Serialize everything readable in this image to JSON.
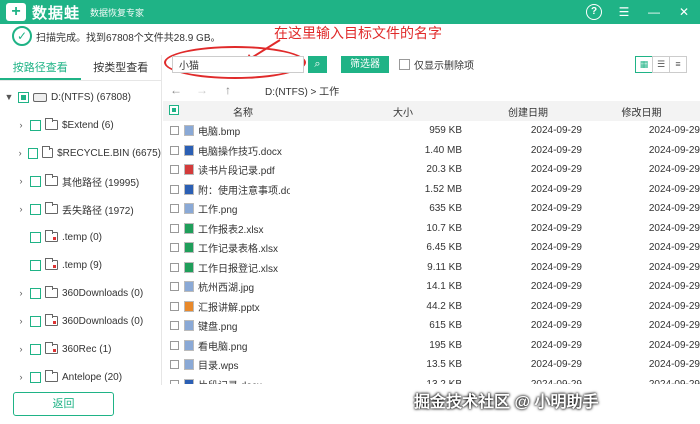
{
  "app": {
    "name": "数据蛙",
    "subtitle": "数据恢复专家",
    "logo_icon": "logo-plus-icon"
  },
  "status": {
    "text": "扫描完成。找到67808个文件共28.9 GB。"
  },
  "annotation": {
    "text": "在这里输入目标文件的名字",
    "color": "#e02a2a"
  },
  "left_tabs": [
    "按路径查看",
    "按类型查看"
  ],
  "tree": [
    {
      "label": "D:(NTFS) (67808)",
      "caret": "▼",
      "icon": "drive-icon",
      "partial": true
    },
    {
      "label": "$Extend (6)",
      "caret": "›",
      "icon": "folder-icon"
    },
    {
      "label": "$RECYCLE.BIN (6675)",
      "caret": "›",
      "icon": "folder-icon"
    },
    {
      "label": "其他路径 (19995)",
      "caret": "›",
      "icon": "folder-icon"
    },
    {
      "label": "丢失路径 (1972)",
      "caret": "›",
      "icon": "folder-icon"
    },
    {
      "label": ".temp (0)",
      "caret": "",
      "icon": "folder-deleted-icon"
    },
    {
      "label": ".temp (9)",
      "caret": "",
      "icon": "folder-deleted-icon"
    },
    {
      "label": "360Downloads (0)",
      "caret": "›",
      "icon": "folder-icon"
    },
    {
      "label": "360Downloads (0)",
      "caret": "›",
      "icon": "folder-deleted-icon"
    },
    {
      "label": "360Rec (1)",
      "caret": "›",
      "icon": "folder-deleted-icon"
    },
    {
      "label": "Antelope (20)",
      "caret": "›",
      "icon": "folder-icon"
    }
  ],
  "back_label": "返回",
  "search": {
    "value": "小猫",
    "filter_label": "筛选器",
    "deleted_only_label": "仅显示删除项"
  },
  "path": "D:(NTFS) > 工作",
  "columns": {
    "name": "名称",
    "size": "大小",
    "created": "创建日期",
    "modified": "修改日期"
  },
  "files": [
    {
      "name": "电脑.bmp",
      "size": "959 KB",
      "created": "2024-09-29",
      "modified": "2024-09-29",
      "icon_color": "#8aa9d6"
    },
    {
      "name": "电脑操作技巧.docx",
      "size": "1.40 MB",
      "created": "2024-09-29",
      "modified": "2024-09-29",
      "icon_color": "#2b5fb4"
    },
    {
      "name": "读书片段记录.pdf",
      "size": "20.3 KB",
      "created": "2024-09-29",
      "modified": "2024-09-29",
      "icon_color": "#d33b3b"
    },
    {
      "name": "附：使用注意事项.docx",
      "size": "1.52 MB",
      "created": "2024-09-29",
      "modified": "2024-09-29",
      "icon_color": "#2b5fb4"
    },
    {
      "name": "工作.png",
      "size": "635 KB",
      "created": "2024-09-29",
      "modified": "2024-09-29",
      "icon_color": "#8aa9d6"
    },
    {
      "name": "工作报表2.xlsx",
      "size": "10.7 KB",
      "created": "2024-09-29",
      "modified": "2024-09-29",
      "icon_color": "#1f9e5a"
    },
    {
      "name": "工作记录表格.xlsx",
      "size": "6.45 KB",
      "created": "2024-09-29",
      "modified": "2024-09-29",
      "icon_color": "#1f9e5a"
    },
    {
      "name": "工作日报登记.xlsx",
      "size": "9.11 KB",
      "created": "2024-09-29",
      "modified": "2024-09-29",
      "icon_color": "#1f9e5a"
    },
    {
      "name": "杭州西湖.jpg",
      "size": "14.1 KB",
      "created": "2024-09-29",
      "modified": "2024-09-29",
      "icon_color": "#8aa9d6"
    },
    {
      "name": "汇报讲解.pptx",
      "size": "44.2 KB",
      "created": "2024-09-29",
      "modified": "2024-09-29",
      "icon_color": "#e8892b"
    },
    {
      "name": "键盘.png",
      "size": "615 KB",
      "created": "2024-09-29",
      "modified": "2024-09-29",
      "icon_color": "#8aa9d6"
    },
    {
      "name": "看电脑.png",
      "size": "195 KB",
      "created": "2024-09-29",
      "modified": "2024-09-29",
      "icon_color": "#8aa9d6"
    },
    {
      "name": "目录.wps",
      "size": "13.5 KB",
      "created": "2024-09-29",
      "modified": "2024-09-29",
      "icon_color": "#8aa9d6"
    },
    {
      "name": "片段记录.docx",
      "size": "13.2 KB",
      "created": "2024-09-29",
      "modified": "2024-09-29",
      "icon_color": "#2b5fb4"
    }
  ],
  "watermark": "掘金技术社区 @ 小明助手",
  "colors": {
    "brand": "#1fb386",
    "annotation": "#e02a2a"
  }
}
